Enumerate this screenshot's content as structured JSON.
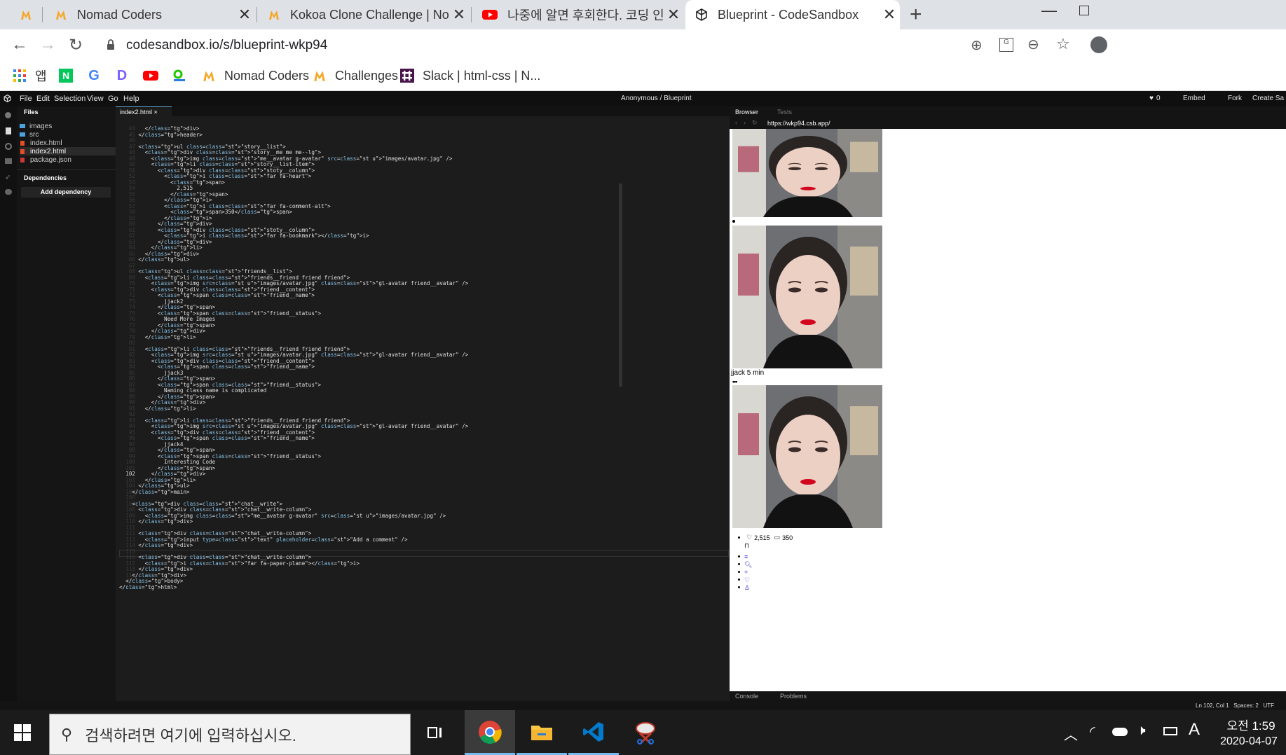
{
  "browser": {
    "tabs": [
      {
        "title": "",
        "icon": "nomad-logo-icon"
      },
      {
        "title": "Nomad Coders",
        "icon": "nomad-logo-icon"
      },
      {
        "title": "Kokoa Clone Challenge | Nomad",
        "icon": "nomad-logo-icon"
      },
      {
        "title": "나중에 알면 후회한다. 코딩 인생",
        "icon": "youtube-icon"
      },
      {
        "title": "Blueprint - CodeSandbox",
        "icon": "codesandbox-icon"
      }
    ],
    "url": "codesandbox.io/s/blueprint-wkp94",
    "bookmarks": [
      {
        "label": "앱",
        "icon": "apps-grid-icon"
      },
      {
        "label": "",
        "icon": "naver-icon"
      },
      {
        "label": "",
        "icon": "google-icon"
      },
      {
        "label": "",
        "icon": "daum-icon"
      },
      {
        "label": "",
        "icon": "youtube-icon"
      },
      {
        "label": "",
        "icon": "map-icon"
      },
      {
        "label": "Nomad Coders",
        "icon": "nomad-logo-icon"
      },
      {
        "label": "Challenges",
        "icon": "nomad-logo-icon"
      },
      {
        "label": "Slack | html-css | N...",
        "icon": "slack-icon"
      }
    ]
  },
  "ide": {
    "menu": [
      "File",
      "Edit",
      "Selection",
      "View",
      "Go",
      "Help"
    ],
    "title": "Anonymous / Blueprint",
    "like_count": "0",
    "embed": "Embed",
    "fork": "Fork",
    "create": "Create Sa",
    "files_label": "Files",
    "files": [
      "images",
      "src",
      "index.html",
      "index2.html",
      "package.json"
    ],
    "dependencies_label": "Dependencies",
    "add_dependency": "Add dependency",
    "active_tab": "index2.html",
    "browser_tab": "Browser",
    "tests_tab": "Tests",
    "preview_url": "https://wkp94.csb.app/",
    "console": "Console",
    "problems": "Problems",
    "status": "Ln 102, Col 1   Spaces: 2   UTF",
    "current_line": "102"
  },
  "code_lines": [
    [
      "        </div>"
    ],
    [
      "      </header>"
    ],
    [
      ""
    ],
    [
      "      <ul class=\"story__list\">"
    ],
    [
      "        <div class=\"story__me me me--lg\">"
    ],
    [
      "          <img class=\"me__avatar g-avatar\" src=\"images/avatar.jpg\" />"
    ],
    [
      "          <li class=\"story__list-item\">"
    ],
    [
      "            <div class=\"stoty__column\">"
    ],
    [
      "              <i class=\"far fa-heart\">"
    ],
    [
      "                <span>"
    ],
    [
      "                  2,515"
    ],
    [
      "                </span>"
    ],
    [
      "              </i>"
    ],
    [
      "              <i class=\"far fa-comment-alt\">"
    ],
    [
      "                <span>350</span>"
    ],
    [
      "              </i>"
    ],
    [
      "            </div>"
    ],
    [
      "            <div class=\"stoty__column\">"
    ],
    [
      "              <i class=\"far fa-bookmark\"></i>"
    ],
    [
      "            </div>"
    ],
    [
      "          </li>"
    ],
    [
      "        </div>"
    ],
    [
      "      </ul>"
    ],
    [
      ""
    ],
    [
      "      <ul class=\"friends__list\">"
    ],
    [
      "        <li class=\"friends__friend friend friend\">"
    ],
    [
      "          <img src=\"images/avatar.jpg\" class=\"gl-avatar friend__avatar\" />"
    ],
    [
      "          <div class=\"friend__content\">"
    ],
    [
      "            <span class=\"friend__name\">"
    ],
    [
      "              jjack2"
    ],
    [
      "            </span>"
    ],
    [
      "            <span class=\"friend__status\">"
    ],
    [
      "              Need More Images"
    ],
    [
      "            </span>"
    ],
    [
      "          </div>"
    ],
    [
      "        </li>"
    ],
    [
      ""
    ],
    [
      "        <li class=\"friends__friend friend friend\">"
    ],
    [
      "          <img src=\"images/avatar.jpg\" class=\"gl-avatar friend__avatar\" />"
    ],
    [
      "          <div class=\"friend__content\">"
    ],
    [
      "            <span class=\"friend__name\">"
    ],
    [
      "              jjack3"
    ],
    [
      "            </span>"
    ],
    [
      "            <span class=\"friend__status\">"
    ],
    [
      "              Naming class name is complicated"
    ],
    [
      "            </span>"
    ],
    [
      "          </div>"
    ],
    [
      "        </li>"
    ],
    [
      ""
    ],
    [
      "        <li class=\"friends__friend friend friend\">"
    ],
    [
      "          <img src=\"images/avatar.jpg\" class=\"gl-avatar friend__avatar\" />"
    ],
    [
      "          <div class=\"friend__content\">"
    ],
    [
      "            <span class=\"friend__name\">"
    ],
    [
      "              jjack4"
    ],
    [
      "            </span>"
    ],
    [
      "            <span class=\"friend__status\">"
    ],
    [
      "              Interesting Code"
    ],
    [
      "            </span>"
    ],
    [
      "          </div>"
    ],
    [
      "        </li>"
    ],
    [
      "      </ul>"
    ],
    [
      "    </main>"
    ],
    [
      ""
    ],
    [
      "    <div class=\"chat__write\">"
    ],
    [
      "      <div class=\"chat__write-column\">"
    ],
    [
      "        <img class=\"me__avatar g-avatar\" src=\"images/avatar.jpg\" />"
    ],
    [
      "      </div>"
    ],
    [
      ""
    ],
    [
      "      <div class=\"chat__write-column\">"
    ],
    [
      "        <input type=\"text\" placeholder=\"Add a comment\" />"
    ],
    [
      "      </div>"
    ],
    [
      ""
    ],
    [
      "      <div class=\"chat__write-column\">"
    ],
    [
      "        <i class=\"far fa-paper-plane\"></i>"
    ],
    [
      "      </div>"
    ],
    [
      "    </div>"
    ],
    [
      "  </body>"
    ],
    [
      "</html>"
    ]
  ],
  "preview": {
    "caption": "jjack 5 min",
    "likes": "2,515",
    "comments": "350",
    "nav_icons": [
      "list-icon",
      "search-icon",
      "plus-icon",
      "heart-icon",
      "user-icon"
    ]
  },
  "taskbar": {
    "search_placeholder": "검색하려면 여기에 입력하십시오.",
    "time": "오전 1:59",
    "date": "2020-04-07",
    "ime": "A"
  }
}
